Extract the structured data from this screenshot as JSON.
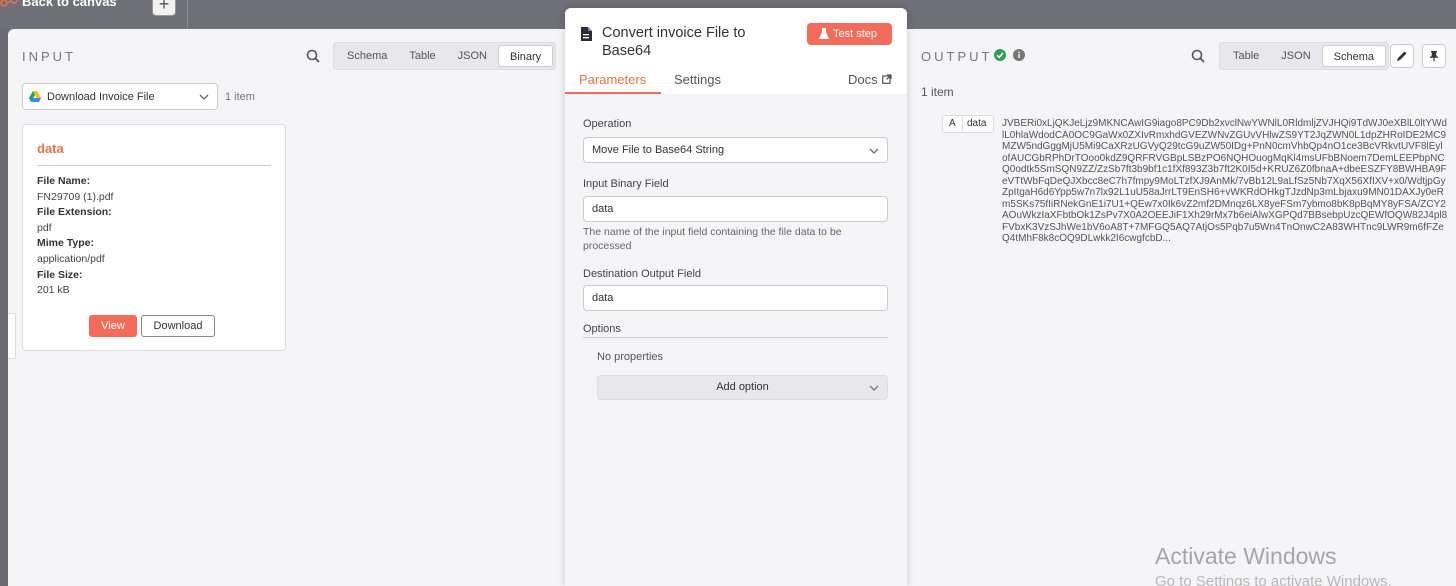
{
  "canvas": {
    "back_label": "Back to canvas",
    "add_symbol": "+"
  },
  "input": {
    "title": "INPUT",
    "view_modes": [
      "Schema",
      "Table",
      "JSON",
      "Binary"
    ],
    "active_view": "Binary",
    "source_node": "Download Invoice File",
    "item_count": "1 item",
    "binary": {
      "name": "data",
      "file_name_label": "File Name:",
      "file_name": "FN29709 (1).pdf",
      "file_ext_label": "File Extension:",
      "file_ext": "pdf",
      "mime_label": "Mime Type:",
      "mime": "application/pdf",
      "size_label": "File Size:",
      "size": "201 kB",
      "view_label": "View",
      "download_label": "Download"
    }
  },
  "node": {
    "title": "Convert invoice File to Base64",
    "test_label": "Test step",
    "tabs": {
      "parameters": "Parameters",
      "settings": "Settings",
      "docs": "Docs"
    },
    "operation_label": "Operation",
    "operation_value": "Move File to Base64 String",
    "input_field_label": "Input Binary Field",
    "input_field_value": "data",
    "input_field_hint": "The name of the input field containing the file data to be processed",
    "dest_field_label": "Destination Output Field",
    "dest_field_value": "data",
    "options_label": "Options",
    "no_props": "No properties",
    "add_option": "Add option"
  },
  "output": {
    "title": "OUTPUT",
    "view_modes": [
      "Table",
      "JSON",
      "Schema"
    ],
    "active_view": "Schema",
    "item_count": "1 item",
    "field_type": "A",
    "field_key": "data",
    "field_value": "JVBERi0xLjQKJeLjz9MKNCAwIG9iago8PC9Db2xvclNwYWNlL0RldmljZVJHQi9TdWJ0eXBlL0ltYWdlL0hlaWdodCA0OC9GaWx0ZXIvRmxhdGVEZWNvZGUvVHlwZS9YT2JqZWN0L1dpZHRoIDE2MC9MZW5ndGggMjU5Mi9CaXRzUGVyQ29tcG9uZW50IDg+PnN0cmVhbQp4nO1ce3BcVRkvtUVF8lEylofAUCGbRPhDrTOoo0kdZ9QRFRVGBpLSBzPO6NQHOuogMqKl4msUFbBNoem7DemLEEPbpNCQ0odtk5SmSQN9ZZ/ZzSb7ft3b9bf1c1fXf893Z3b7ft2K0I5d+KRUZ6Z0fbnaA+dbeESZFY8BWHBA9FeVTtWbFqDeQJXbcc8eC7h7fmpy9MoLTzfXJ9AnMk/7vBb12L9aLfSz5Nb7XqX56XfIXV+x0/WdtjpGyZpItgaH6d6Ypp5w7n7lx92L1uU58aJrrLT9EnSH6+vWKRdOHkgTJzdNp3mLbjaxu9MN01DAXJy0eRm5SKs75fIiRNekGnE1i7U1+QEw7x0Ik6vZ2mf2DMnqz6LX8yeFSm7ybmo8bK8pBqMY8yFSA/ZCY2AOuWkzIaXFbtbOk1ZsPv7X0A2OEEJiF1Xh29rMx7b6eiAlwXGPQd7BBsebpUzcQEWfOQW82J4pl8FVbxK3VzSJhWe1bV6oA8T+7MFGQ5AQ7AtjOs5Pqb7u5Wn4TnOnwC2A83WHTnc9LWR9m6fFZeQ4tMhF8k8cOQ9DLwkk2I6cwgfcbD..."
  },
  "watermark": {
    "line1": "Activate Windows",
    "line2": "Go to Settings to activate Windows."
  }
}
